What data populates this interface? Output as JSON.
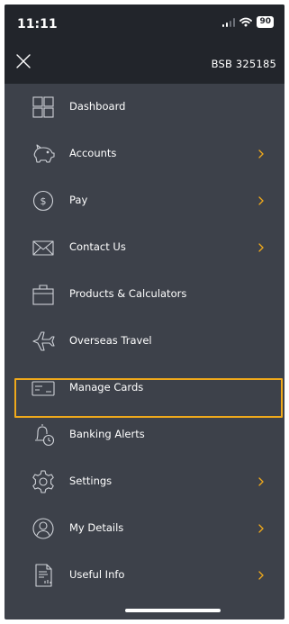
{
  "status_bar": {
    "time": "11:11",
    "battery": "90"
  },
  "header": {
    "bsb": "BSB 325185"
  },
  "menu": {
    "items": [
      {
        "label": "Dashboard",
        "icon": "dashboard-grid-icon",
        "chevron": false
      },
      {
        "label": "Accounts",
        "icon": "piggy-bank-icon",
        "chevron": true
      },
      {
        "label": "Pay",
        "icon": "dollar-circle-icon",
        "chevron": true
      },
      {
        "label": "Contact Us",
        "icon": "envelope-icon",
        "chevron": true
      },
      {
        "label": "Products & Calculators",
        "icon": "briefcase-icon",
        "chevron": false
      },
      {
        "label": "Overseas Travel",
        "icon": "airplane-icon",
        "chevron": false
      },
      {
        "label": "Manage Cards",
        "icon": "credit-card-icon",
        "chevron": false
      },
      {
        "label": "Banking Alerts",
        "icon": "bell-clock-icon",
        "chevron": false
      },
      {
        "label": "Settings",
        "icon": "gear-icon",
        "chevron": true,
        "highlighted": true
      },
      {
        "label": "My Details",
        "icon": "user-circle-icon",
        "chevron": true
      },
      {
        "label": "Useful Info",
        "icon": "document-info-icon",
        "chevron": true
      }
    ]
  },
  "colors": {
    "background": "#3d414a",
    "header": "#22252b",
    "chevron": "#f0a91b",
    "highlight": "#f0a91b"
  }
}
